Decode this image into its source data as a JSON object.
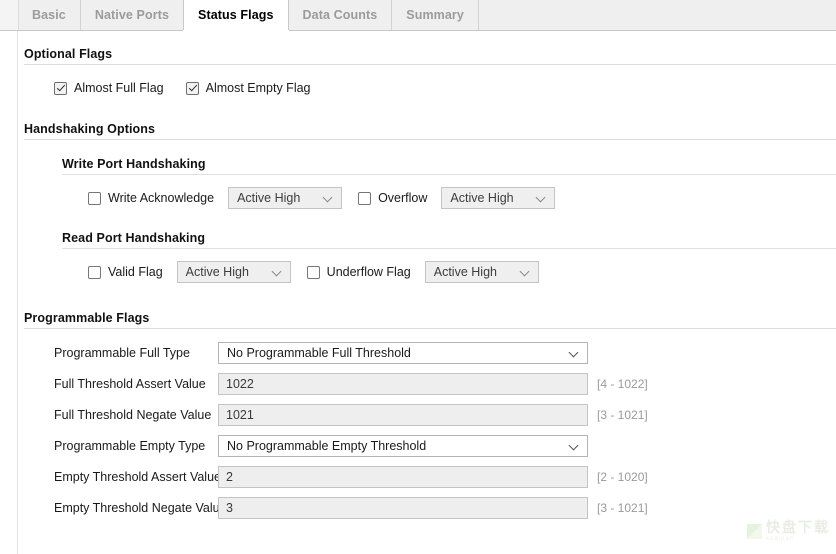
{
  "tabs": [
    {
      "label": "Basic",
      "active": false
    },
    {
      "label": "Native Ports",
      "active": false
    },
    {
      "label": "Status Flags",
      "active": true
    },
    {
      "label": "Data Counts",
      "active": false
    },
    {
      "label": "Summary",
      "active": false
    }
  ],
  "optional_flags": {
    "title": "Optional Flags",
    "checkboxes": [
      {
        "label": "Almost Full Flag",
        "checked": true
      },
      {
        "label": "Almost Empty Flag",
        "checked": true
      }
    ]
  },
  "handshaking": {
    "title": "Handshaking Options",
    "write_port": {
      "title": "Write Port Handshaking",
      "ack_checkbox": {
        "label": "Write Acknowledge",
        "checked": false
      },
      "ack_select": {
        "value": "Active High",
        "enabled": false
      },
      "overflow_checkbox": {
        "label": "Overflow",
        "checked": false
      },
      "overflow_select": {
        "value": "Active High",
        "enabled": false
      }
    },
    "read_port": {
      "title": "Read Port Handshaking",
      "valid_checkbox": {
        "label": "Valid Flag",
        "checked": false
      },
      "valid_select": {
        "value": "Active High",
        "enabled": false
      },
      "underflow_checkbox": {
        "label": "Underflow Flag",
        "checked": false
      },
      "underflow_select": {
        "value": "Active High",
        "enabled": false
      }
    }
  },
  "programmable_flags": {
    "title": "Programmable Flags",
    "rows": [
      {
        "label": "Programmable Full Type",
        "type": "select",
        "value": "No Programmable Full Threshold",
        "enabled": true,
        "range": ""
      },
      {
        "label": "Full Threshold Assert Value",
        "type": "input",
        "value": "1022",
        "enabled": false,
        "range": "[4 - 1022]"
      },
      {
        "label": "Full Threshold Negate Value",
        "type": "input",
        "value": "1021",
        "enabled": false,
        "range": "[3 - 1021]"
      },
      {
        "label": "Programmable Empty Type",
        "type": "select",
        "value": "No Programmable Empty Threshold",
        "enabled": true,
        "range": ""
      },
      {
        "label": "Empty Threshold Assert Value",
        "type": "input",
        "value": "2",
        "enabled": false,
        "range": "[2 - 1020]"
      },
      {
        "label": "Empty Threshold Negate Value",
        "type": "input",
        "value": "3",
        "enabled": false,
        "range": "[3 - 1021]"
      }
    ]
  },
  "watermark": {
    "text": "快盘下载",
    "sub": "kuaipan"
  },
  "colors": {
    "tab_active_bg": "#ffffff",
    "tab_inactive_bg": "#efefef",
    "tab_inactive_text": "#9b9b9b",
    "range_text": "#9a9a9a",
    "disabled_field_bg": "#eeeeee"
  }
}
